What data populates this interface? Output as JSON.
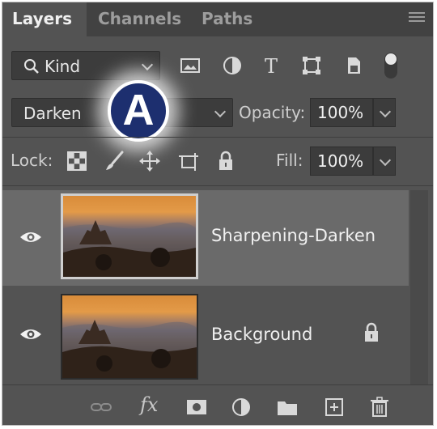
{
  "tabs": [
    {
      "label": "Layers",
      "active": true
    },
    {
      "label": "Channels",
      "active": false
    },
    {
      "label": "Paths",
      "active": false
    }
  ],
  "filter": {
    "kind_label": "Kind",
    "filter_icons": [
      "image-filter-icon",
      "adjustment-filter-icon",
      "type-filter-icon",
      "shape-filter-icon",
      "smart-object-filter-icon",
      "filter-toggle-icon"
    ]
  },
  "blend": {
    "mode": "Darken",
    "opacity_label": "Opacity:",
    "opacity_value": "100%"
  },
  "badge_label": "A",
  "lock": {
    "label": "Lock:",
    "icons": [
      "lock-transparent-pixels-icon",
      "lock-image-pixels-icon",
      "lock-position-icon",
      "lock-artboard-icon",
      "lock-all-icon"
    ],
    "fill_label": "Fill:",
    "fill_value": "100%"
  },
  "layers": [
    {
      "name": "Sharpening-Darken",
      "selected": true,
      "visible": true,
      "locked": false
    },
    {
      "name": "Background",
      "selected": false,
      "visible": true,
      "locked": true
    }
  ],
  "bottom_icons": [
    "link-layers-icon",
    "fx-icon",
    "add-mask-icon",
    "adjustment-layer-icon",
    "new-group-icon",
    "new-layer-icon",
    "delete-icon"
  ],
  "fx_text": "fx",
  "colors": {
    "panel": "#535353",
    "tabbar": "#424242",
    "selected_row": "#6a6a6a",
    "badge": "#1d2f6f"
  }
}
